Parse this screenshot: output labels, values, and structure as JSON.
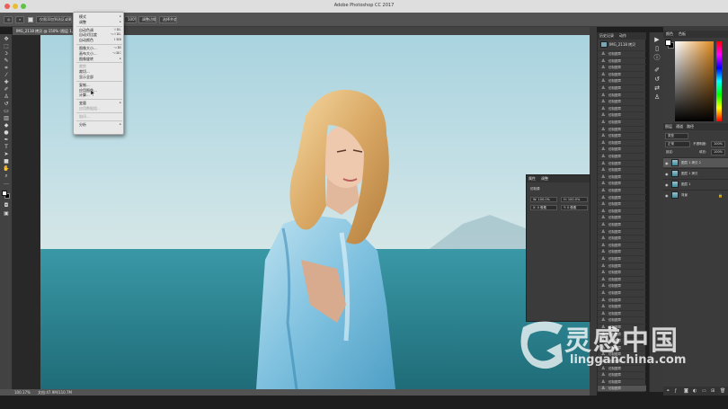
{
  "window": {
    "title": "Adobe Photoshop CC 2017"
  },
  "options_bar": {
    "controls": [
      "仅限添加到选区或删除…",
      "100%",
      "调整边缘",
      "选择并遮住",
      "1,0",
      "100%"
    ]
  },
  "document": {
    "tab_label": "IMG_2118 拷贝 @ 150% (图层 1, RGB/8)"
  },
  "status_bar": {
    "zoom": "100.17%",
    "doc_size": "文档:47.9M/110.7M"
  },
  "menu": {
    "items": [
      {
        "label": "模式",
        "shortcut": "▸",
        "enabled": true
      },
      {
        "label": "调整",
        "shortcut": "▸",
        "enabled": true
      },
      {
        "label": "自动色调",
        "shortcut": "⇧⌘L",
        "enabled": true
      },
      {
        "label": "自动对比度",
        "shortcut": "⌥⇧⌘L",
        "enabled": true
      },
      {
        "label": "自动颜色",
        "shortcut": "⇧⌘B",
        "enabled": true
      },
      {
        "label": "图像大小...",
        "shortcut": "⌥⌘I",
        "enabled": true
      },
      {
        "label": "画布大小...",
        "shortcut": "⌥⌘C",
        "enabled": true
      },
      {
        "label": "图像旋转",
        "shortcut": "▸",
        "enabled": true
      },
      {
        "label": "裁剪",
        "shortcut": "",
        "enabled": false
      },
      {
        "label": "裁切...",
        "shortcut": "",
        "enabled": true
      },
      {
        "label": "显示全部",
        "shortcut": "",
        "enabled": true
      },
      {
        "label": "复制...",
        "shortcut": "",
        "enabled": true
      },
      {
        "label": "应用图像...",
        "shortcut": "",
        "enabled": true
      },
      {
        "label": "计算...",
        "shortcut": "",
        "enabled": true
      },
      {
        "label": "变量",
        "shortcut": "▸",
        "enabled": true
      },
      {
        "label": "应用数据组...",
        "shortcut": "",
        "enabled": false
      },
      {
        "label": "陷印...",
        "shortcut": "",
        "enabled": false
      },
      {
        "label": "分析",
        "shortcut": "▸",
        "enabled": true
      }
    ]
  },
  "history": {
    "tabs": [
      "历史记录",
      "动作"
    ],
    "snapshot_label": "IMG_2118 拷贝",
    "item_label": "仿制图章",
    "item_count": 50
  },
  "properties": {
    "tabs": [
      "属性",
      "调整"
    ],
    "title": "仿制源",
    "fields": [
      "W: 100.0%",
      "H: 100.0%",
      "X: 0 像素",
      "Y: 0 像素",
      "0.0°"
    ]
  },
  "color_panel": {
    "tabs": [
      "颜色",
      "色板"
    ],
    "accent": "#e08a1e"
  },
  "layers_panel": {
    "tabs": [
      "图层",
      "通道",
      "路径"
    ],
    "filter_label": "类型",
    "blend_mode": "正常",
    "opacity_label": "不透明度:",
    "opacity_value": "100%",
    "lock_label": "锁定:",
    "fill_label": "填充:",
    "fill_value": "100%",
    "layers": [
      {
        "name": "图层 1 拷贝 2",
        "selected": true
      },
      {
        "name": "图层 1 拷贝",
        "selected": false
      },
      {
        "name": "图层 1",
        "selected": false
      },
      {
        "name": "背景",
        "selected": false,
        "locked": true
      }
    ]
  },
  "watermark": {
    "brand": "灵感中国",
    "url": "lingganchina.com"
  }
}
